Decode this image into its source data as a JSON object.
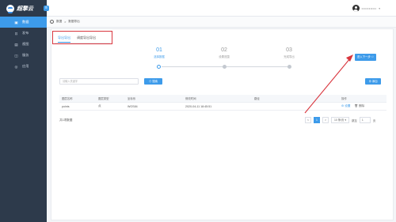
{
  "brand": {
    "name": "超擎云",
    "collapse_icon": "≡"
  },
  "sidebar": {
    "items": [
      {
        "label": "数据",
        "icon": "folder-icon",
        "glyph": "▣",
        "active": true
      },
      {
        "label": "发布",
        "icon": "publish-icon",
        "glyph": "⊡",
        "active": false
      },
      {
        "label": "视图",
        "icon": "view-icon",
        "glyph": "▤",
        "active": false
      },
      {
        "label": "服务",
        "icon": "service-icon",
        "glyph": "◫",
        "active": false
      },
      {
        "label": "应用",
        "icon": "app-icon",
        "glyph": "◎",
        "active": false
      }
    ]
  },
  "topbar": {
    "user_name": "••••••••••••",
    "caret": "▾"
  },
  "breadcrumb": {
    "back": "‹",
    "root": "数据",
    "sep": ">",
    "current": "数据导出"
  },
  "tabs": [
    {
      "label": "导出导出",
      "active": true
    },
    {
      "label": "调度导出导出",
      "active": false
    }
  ],
  "steps": [
    {
      "num": "01",
      "label": "选择数据",
      "active": true
    },
    {
      "num": "02",
      "label": "设置范围",
      "active": false
    },
    {
      "num": "03",
      "label": "完成导出",
      "active": false
    }
  ],
  "next_button": "进入下一步 ⇨",
  "search": {
    "placeholder": "请输入关键字",
    "button": "⊙ 搜索"
  },
  "add_button": "⊕ 添加",
  "table": {
    "headers": [
      "图层名称",
      "图层类型",
      "坐标系",
      "修改时间",
      "路径",
      "操作"
    ],
    "rows": [
      {
        "name": "points",
        "type": "点",
        "crs": "WGS84",
        "time": "2020-04-11 18:45:51",
        "path": "",
        "ops": [
          "⚙ 设置",
          "🗑 删除"
        ]
      }
    ]
  },
  "pager": {
    "total": "共1项数据",
    "prev": "<",
    "page": "1",
    "next": ">",
    "size": "10 条/页 ▾",
    "goto_label": "跳至",
    "goto_value": "1",
    "page_suffix": "页"
  },
  "colors": {
    "accent": "#3d9bea",
    "sidebar": "#2d3a4b",
    "annotation": "#d9363e"
  }
}
